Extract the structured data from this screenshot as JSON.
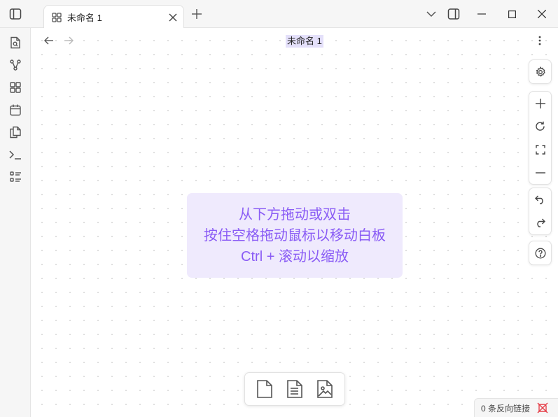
{
  "titlebar": {
    "tab_title": "未命名 1"
  },
  "view": {
    "title": "未命名 1"
  },
  "hint": {
    "line1": "从下方拖动或双击",
    "line2": "按住空格拖动鼠标以移动白板",
    "line3": "Ctrl + 滚动以缩放"
  },
  "status": {
    "backlinks": "0 条反向链接"
  },
  "colors": {
    "accent": "#8a5cf5",
    "hint_bg": "#efeafd",
    "title_highlight": "#e4e0fa",
    "status_icon": "#e5404a"
  }
}
